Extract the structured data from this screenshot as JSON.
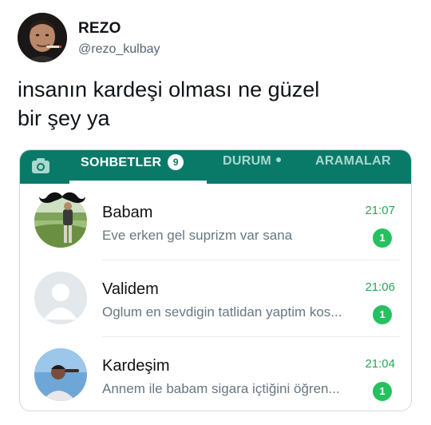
{
  "tweet": {
    "author_name": "REZO",
    "author_handle": "@rezo_kulbay",
    "text_line1": "insanın kardeşi olması ne güzel",
    "text_line2": "bir şey ya"
  },
  "whatsapp": {
    "tabs": {
      "camera_icon": "camera-icon",
      "chats": "SOHBETLER",
      "chats_badge": "9",
      "status": "DURUM",
      "calls": "ARAMALAR"
    },
    "chats": [
      {
        "name": "Babam",
        "preview": "Eve erken gel suprizm var sana",
        "time": "21:07",
        "unread": "1"
      },
      {
        "name": "Validem",
        "preview": "Oglum en sevdigin tatlidan yaptim kos...",
        "time": "21:06",
        "unread": "1"
      },
      {
        "name": "Kardeşim",
        "preview": "Annem ile babam sigara içtiğini öğren...",
        "time": "21:04",
        "unread": "1"
      }
    ],
    "colors": {
      "header": "#0a7a68",
      "accent_green": "#25c15f",
      "time_green": "#25a855"
    }
  }
}
